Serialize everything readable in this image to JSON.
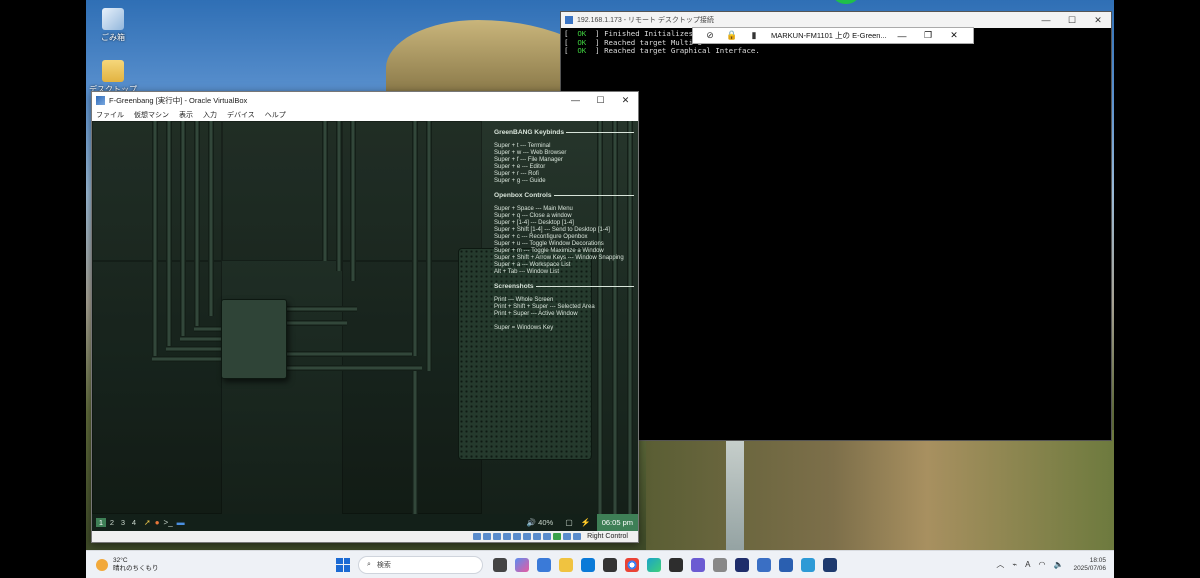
{
  "desktop": {
    "icons": [
      {
        "label": "ごみ箱"
      },
      {
        "label": "デスクトップ"
      }
    ]
  },
  "rdp": {
    "title": "192.168.1.173 - リモート デスクトップ接続",
    "connection_bar_title": "MARKUN-FM1101 上の E-Green...",
    "lines": [
      {
        "status": "OK",
        "text": "Finished Initializes P"
      },
      {
        "status": "OK",
        "text": "Reached target Multi-U"
      },
      {
        "status": "OK",
        "text": "Reached target Graphical Interface."
      }
    ]
  },
  "vbox": {
    "title": "F-Greenbang [実行中] - Oracle VirtualBox",
    "menu": [
      "ファイル",
      "仮想マシン",
      "表示",
      "入力",
      "デバイス",
      "ヘルプ"
    ],
    "status_host_key": "Right Control"
  },
  "vm": {
    "keybinds": {
      "heading1": "GreenBANG Keybinds",
      "greenbang": [
        "Super + t --- Terminal",
        "Super + w --- Web Browser",
        "Super + f --- File Manager",
        "Super + e --- Editor",
        "Super + r --- Rofi",
        "Super + g --- Guide"
      ],
      "heading2": "Openbox Controls",
      "openbox": [
        "Super + Space --- Main Menu",
        "Super + q --- Close a window",
        "Super + [1-4] --- Desktop [1-4]",
        "Super + Shift [1-4] --- Send to Desktop [1-4]",
        "Super + c --- Reconfigure Openbox",
        "Super + u --- Toggle Window Decorations",
        "Super + m --- Toggle Maximize a Window",
        "Super + Shift + Arrow Keys --- Window Snapping",
        "Super + a --- Workspace List",
        "Alt + Tab --- Window List"
      ],
      "heading3": "Screenshots",
      "screenshots": [
        "Print --- Whole Screen",
        "Print + Shift + Super --- Selected Area",
        "Print + Super --- Active Window"
      ],
      "super_note": "Super = Windows Key"
    },
    "panel": {
      "workspaces": [
        "1",
        "2",
        "3",
        "4"
      ],
      "volume": "40%",
      "clock": "06:05 pm"
    }
  },
  "taskbar": {
    "weather_temp": "32°C",
    "weather_desc": "晴れのちくもり",
    "search_placeholder": "検索",
    "time": "18:05",
    "date": "2025/07/06",
    "ime": "A"
  }
}
